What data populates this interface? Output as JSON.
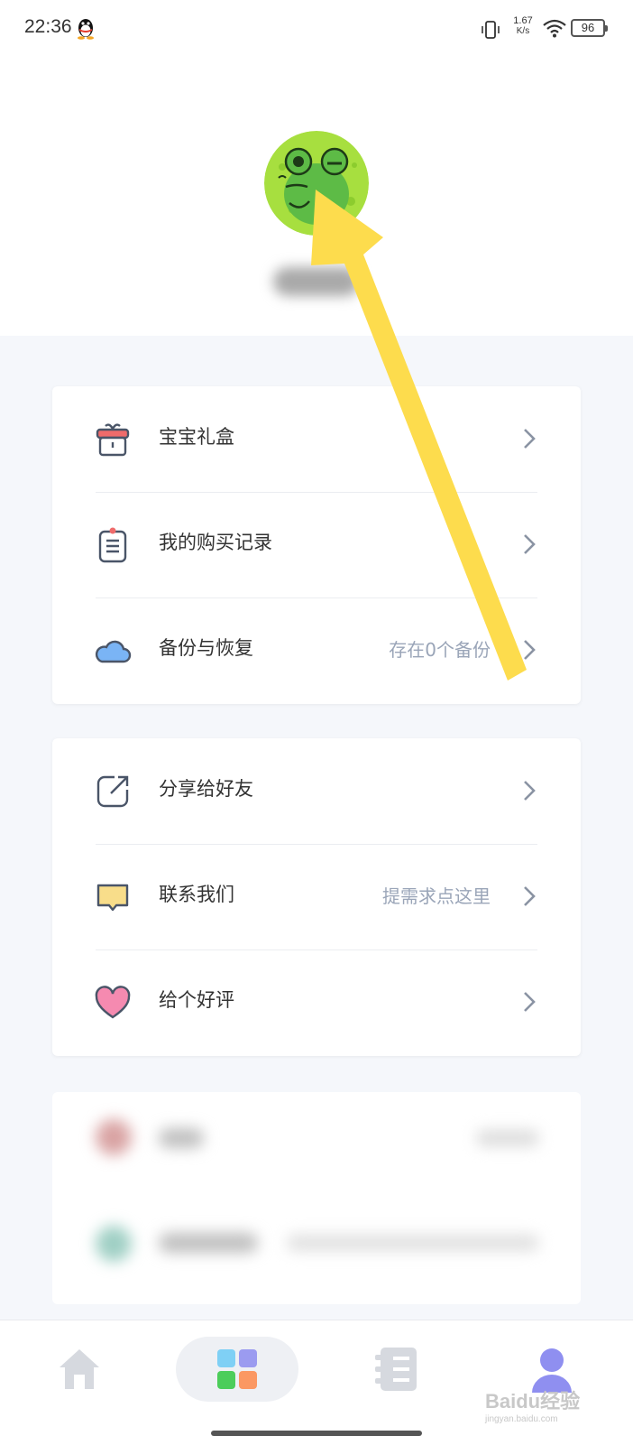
{
  "status_bar": {
    "time": "22:36",
    "network_speed": "1.67",
    "network_unit": "K/s",
    "battery": "96"
  },
  "profile": {
    "avatar": "frog-avatar-icon"
  },
  "menu_group_1": {
    "items": [
      {
        "label": "宝宝礼盒",
        "subtitle": "",
        "icon": "gift-box-icon"
      },
      {
        "label": "我的购买记录",
        "subtitle": "",
        "icon": "purchase-record-icon"
      },
      {
        "label": "备份与恢复",
        "subtitle": "存在0个备份",
        "icon": "cloud-icon"
      }
    ]
  },
  "menu_group_2": {
    "items": [
      {
        "label": "分享给好友",
        "subtitle": "",
        "icon": "share-icon"
      },
      {
        "label": "联系我们",
        "subtitle": "提需求点这里",
        "icon": "message-icon"
      },
      {
        "label": "给个好评",
        "subtitle": "",
        "icon": "heart-icon"
      }
    ]
  },
  "tab_bar": {
    "tabs": [
      {
        "icon": "home-icon",
        "active": false
      },
      {
        "icon": "grid-apps-icon",
        "active": true
      },
      {
        "icon": "list-book-icon",
        "active": false
      },
      {
        "icon": "profile-icon",
        "active": false
      }
    ]
  },
  "watermark": {
    "brand": "Baidu经验",
    "url": "jingyan.baidu.com"
  },
  "colors": {
    "accent_yellow_arrow": "#fddc4d",
    "page_bg": "#f5f7fb",
    "subtitle": "#9aa5b8"
  }
}
